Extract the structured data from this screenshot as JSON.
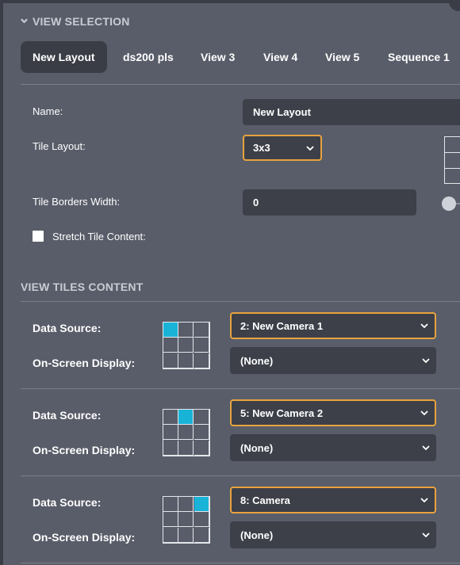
{
  "header": {
    "title": "VIEW SELECTION"
  },
  "tabs": [
    {
      "label": "New Layout",
      "active": true
    },
    {
      "label": "ds200 pls",
      "active": false
    },
    {
      "label": "View 3",
      "active": false
    },
    {
      "label": "View 4",
      "active": false
    },
    {
      "label": "View 5",
      "active": false
    },
    {
      "label": "Sequence 1",
      "active": false
    }
  ],
  "layout_form": {
    "name_label": "Name:",
    "name_value": "New Layout",
    "tile_layout_label": "Tile Layout:",
    "tile_layout_value": "3x3",
    "tile_borders_label": "Tile Borders Width:",
    "tile_borders_value": "0",
    "stretch_label": "Stretch Tile Content:",
    "stretch_checked": false
  },
  "tiles_section": {
    "title": "VIEW TILES CONTENT",
    "data_source_label": "Data Source:",
    "osd_label": "On-Screen Display:",
    "tiles": [
      {
        "data_source": "2: New Camera 1",
        "osd": "(None)",
        "highlight_cell": 0
      },
      {
        "data_source": "5: New Camera 2",
        "osd": "(None)",
        "highlight_cell": 1
      },
      {
        "data_source": "8: Camera",
        "osd": "(None)",
        "highlight_cell": 2
      }
    ]
  },
  "colors": {
    "background": "#595d69",
    "panel_dark": "#3a3d45",
    "field_bg": "#3d4049",
    "focus_border": "#e8a33d",
    "tile_highlight": "#1ab3d8"
  }
}
